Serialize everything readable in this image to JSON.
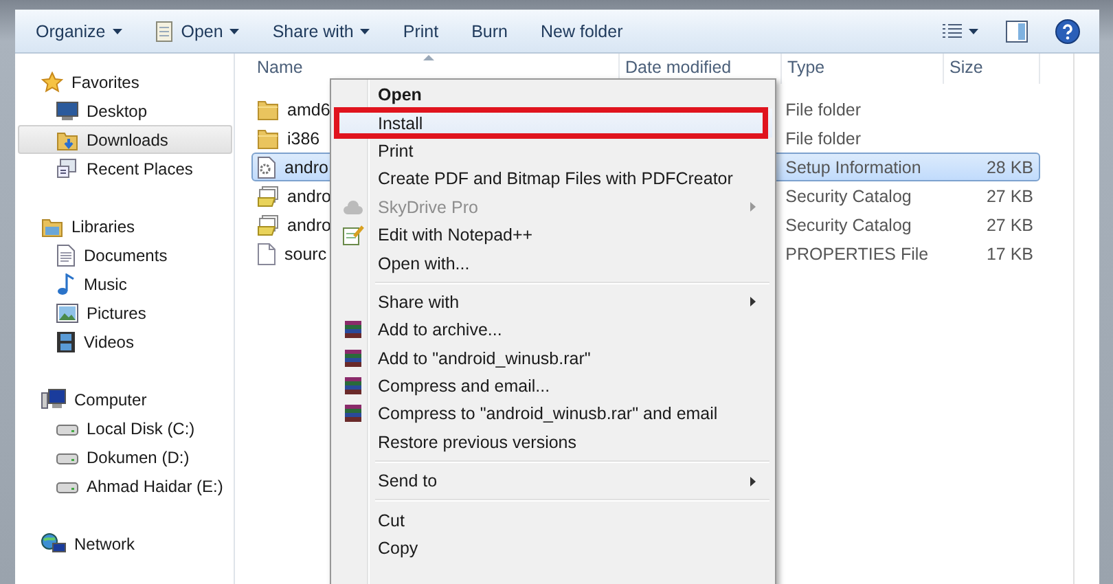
{
  "toolbar": {
    "items": [
      {
        "label": "Organize",
        "kind": "dropdown"
      },
      {
        "label": "Open",
        "kind": "app-dropdown"
      },
      {
        "label": "Share with",
        "kind": "dropdown"
      },
      {
        "label": "Print",
        "kind": "button"
      },
      {
        "label": "Burn",
        "kind": "button"
      },
      {
        "label": "New folder",
        "kind": "button"
      }
    ]
  },
  "navigation": {
    "sections": [
      {
        "label": "Favorites",
        "kind": "favorites",
        "children": [
          {
            "label": "Desktop",
            "kind": "desktop",
            "selected": false
          },
          {
            "label": "Downloads",
            "kind": "downloads",
            "selected": true
          },
          {
            "label": "Recent Places",
            "kind": "recent",
            "selected": false
          }
        ]
      },
      {
        "label": "Libraries",
        "kind": "libraries",
        "children": [
          {
            "label": "Documents",
            "kind": "documents",
            "selected": false
          },
          {
            "label": "Music",
            "kind": "music",
            "selected": false
          },
          {
            "label": "Pictures",
            "kind": "pictures",
            "selected": false
          },
          {
            "label": "Videos",
            "kind": "videos",
            "selected": false
          }
        ]
      },
      {
        "label": "Computer",
        "kind": "computer",
        "children": [
          {
            "label": "Local Disk (C:)",
            "kind": "drive",
            "selected": false
          },
          {
            "label": "Dokumen (D:)",
            "kind": "drive",
            "selected": false
          },
          {
            "label": "Ahmad Haidar (E:)",
            "kind": "drive",
            "selected": false
          }
        ]
      },
      {
        "label": "Network",
        "kind": "network"
      }
    ]
  },
  "file_list": {
    "columns": [
      "Name",
      "Date modified",
      "Type",
      "Size"
    ],
    "rows": [
      {
        "name": "amd6",
        "type": "File folder",
        "size": "",
        "kind": "folder",
        "selected": false
      },
      {
        "name": "i386",
        "type": "File folder",
        "size": "",
        "kind": "folder",
        "selected": false
      },
      {
        "name": "andro",
        "type": "Setup Information",
        "size": "28 KB",
        "kind": "setup",
        "selected": true
      },
      {
        "name": "andro",
        "type": "Security Catalog",
        "size": "27 KB",
        "kind": "catalog",
        "selected": false
      },
      {
        "name": "andro",
        "type": "Security Catalog",
        "size": "27 KB",
        "kind": "catalog",
        "selected": false
      },
      {
        "name": "sourc",
        "type": "PROPERTIES File",
        "size": "17 KB",
        "kind": "file",
        "selected": false
      }
    ]
  },
  "context_menu": {
    "items": [
      {
        "kind": "item",
        "label": "Open",
        "default": true,
        "disabled": false,
        "submenu": false,
        "highlighted": false,
        "annotated": false
      },
      {
        "kind": "item",
        "label": "Install",
        "default": false,
        "disabled": false,
        "submenu": false,
        "highlighted": true,
        "annotated": true
      },
      {
        "kind": "item",
        "label": "Print",
        "default": false,
        "disabled": false,
        "submenu": false,
        "highlighted": false,
        "annotated": false
      },
      {
        "kind": "item",
        "label": "Create PDF and Bitmap Files with PDFCreator",
        "default": false,
        "disabled": false,
        "submenu": false,
        "highlighted": false,
        "annotated": false
      },
      {
        "kind": "cloud-item",
        "label": "SkyDrive Pro",
        "default": false,
        "disabled": true,
        "submenu": true,
        "highlighted": false,
        "annotated": false
      },
      {
        "kind": "notepad-item",
        "label": "Edit with Notepad++",
        "default": false,
        "disabled": false,
        "submenu": false,
        "highlighted": false,
        "annotated": false
      },
      {
        "kind": "item",
        "label": "Open with...",
        "default": false,
        "disabled": false,
        "submenu": false,
        "highlighted": false,
        "annotated": false
      },
      {
        "kind": "separator"
      },
      {
        "kind": "item",
        "label": "Share with",
        "default": false,
        "disabled": false,
        "submenu": true,
        "highlighted": false,
        "annotated": false
      },
      {
        "kind": "rar-item",
        "label": "Add to archive...",
        "default": false,
        "disabled": false,
        "submenu": false,
        "highlighted": false,
        "annotated": false
      },
      {
        "kind": "rar-item",
        "label": "Add to \"android_winusb.rar\"",
        "default": false,
        "disabled": false,
        "submenu": false,
        "highlighted": false,
        "annotated": false
      },
      {
        "kind": "rar-item",
        "label": "Compress and email...",
        "default": false,
        "disabled": false,
        "submenu": false,
        "highlighted": false,
        "annotated": false
      },
      {
        "kind": "rar-item",
        "label": "Compress to \"android_winusb.rar\" and email",
        "default": false,
        "disabled": false,
        "submenu": false,
        "highlighted": false,
        "annotated": false
      },
      {
        "kind": "item",
        "label": "Restore previous versions",
        "default": false,
        "disabled": false,
        "submenu": false,
        "highlighted": false,
        "annotated": false
      },
      {
        "kind": "separator"
      },
      {
        "kind": "item",
        "label": "Send to",
        "default": false,
        "disabled": false,
        "submenu": true,
        "highlighted": false,
        "annotated": false
      },
      {
        "kind": "separator"
      },
      {
        "kind": "item",
        "label": "Cut",
        "default": false,
        "disabled": false,
        "submenu": false,
        "highlighted": false,
        "annotated": false
      },
      {
        "kind": "item",
        "label": "Copy",
        "default": false,
        "disabled": false,
        "submenu": false,
        "highlighted": false,
        "annotated": false
      }
    ]
  }
}
